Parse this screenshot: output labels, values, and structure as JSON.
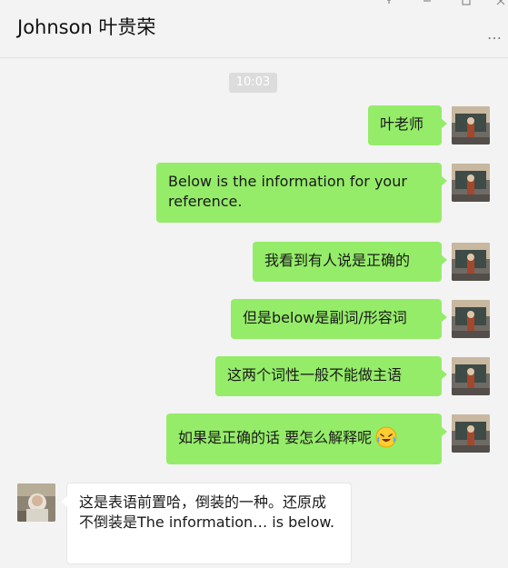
{
  "header": {
    "contact_name": "Johnson 叶贵荣",
    "more_icon": "…"
  },
  "timestamp": "10:03",
  "messages": [
    {
      "side": "right",
      "text": "叶老师"
    },
    {
      "side": "right",
      "text": "Below is the information for your reference."
    },
    {
      "side": "right",
      "text": "我看到有人说是正确的"
    },
    {
      "side": "right",
      "text": "但是below是副词/形容词"
    },
    {
      "side": "right",
      "text": "这两个词性一般不能做主语"
    },
    {
      "side": "right",
      "text": "如果是正确的话 要怎么解释呢",
      "emoji": "laughing-crying-emoji"
    },
    {
      "side": "left",
      "text": "这是表语前置哈，倒装的一种。还原成不倒装是The information… is below."
    }
  ],
  "colors": {
    "outgoing_bubble": "#95ec69",
    "incoming_bubble": "#ffffff",
    "background": "#f3f3f3"
  }
}
